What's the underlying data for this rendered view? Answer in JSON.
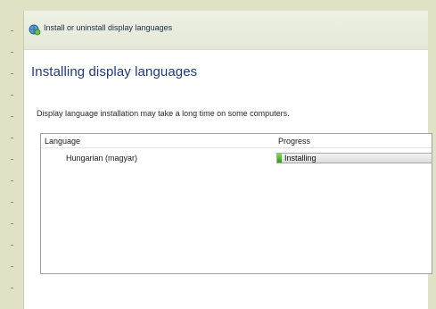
{
  "window": {
    "title": "Install or uninstall display languages"
  },
  "main": {
    "heading": "Installing display languages",
    "description": "Display language installation may take a long time on some computers."
  },
  "table": {
    "columns": [
      "Language",
      "Progress"
    ],
    "rows": [
      {
        "language": "Hungarian (magyar)",
        "status": "Installing",
        "progress_fraction": 0.03
      }
    ]
  },
  "colors": {
    "heading": "#1e3b78",
    "progress_green": "#2e9a1c",
    "background": "#dfe2c4"
  },
  "icons": {
    "title_icon": "globe-icon"
  }
}
